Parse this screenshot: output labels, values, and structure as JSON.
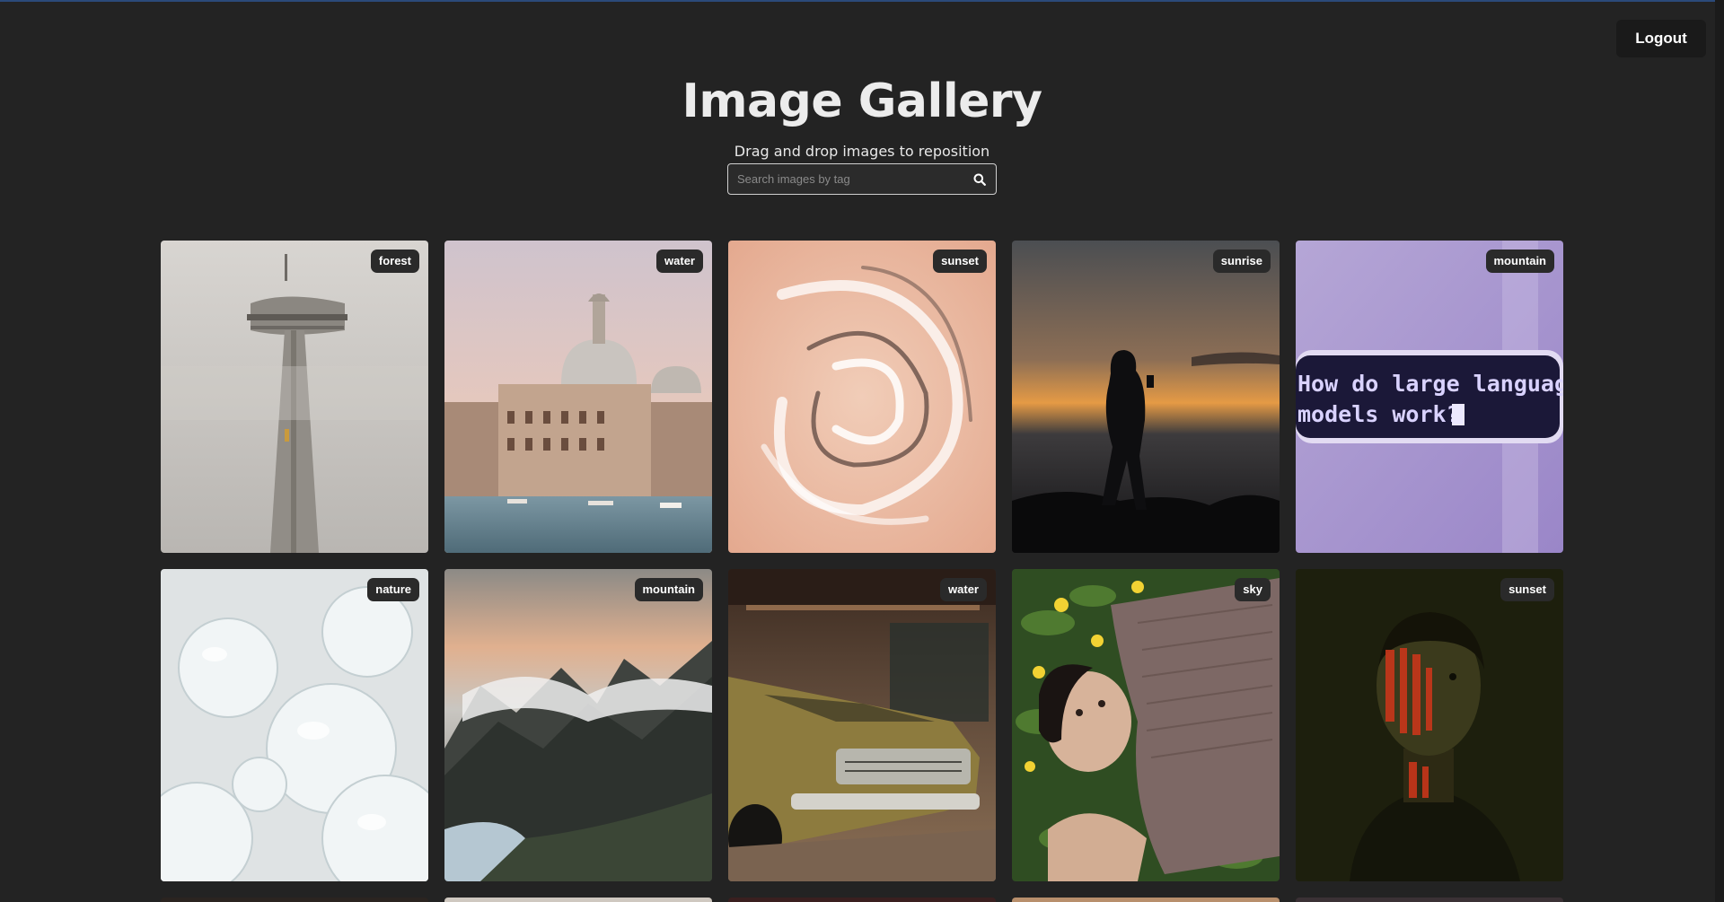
{
  "header": {
    "title": "Image Gallery",
    "subtitle": "Drag and drop images to reposition",
    "logout_label": "Logout"
  },
  "search": {
    "placeholder": "Search images by tag",
    "value": "",
    "icon": "search-icon"
  },
  "gallery": {
    "images": [
      {
        "tag": "forest",
        "subject": "fog-tower"
      },
      {
        "tag": "water",
        "subject": "venice-canal"
      },
      {
        "tag": "sunset",
        "subject": "glass-swirl"
      },
      {
        "tag": "sunrise",
        "subject": "silhouette-person"
      },
      {
        "tag": "mountain",
        "subject": "llm-screen-text",
        "text": "How do large language models work?"
      },
      {
        "tag": "nature",
        "subject": "glass-bubbles"
      },
      {
        "tag": "mountain",
        "subject": "fjord-mountains"
      },
      {
        "tag": "water",
        "subject": "vintage-car"
      },
      {
        "tag": "sky",
        "subject": "man-lying-in-flowers"
      },
      {
        "tag": "sunset",
        "subject": "portrait-red-light"
      }
    ]
  },
  "colors": {
    "background": "#232323",
    "badge": "#2a2a2a",
    "button": "#1a1a1a"
  }
}
